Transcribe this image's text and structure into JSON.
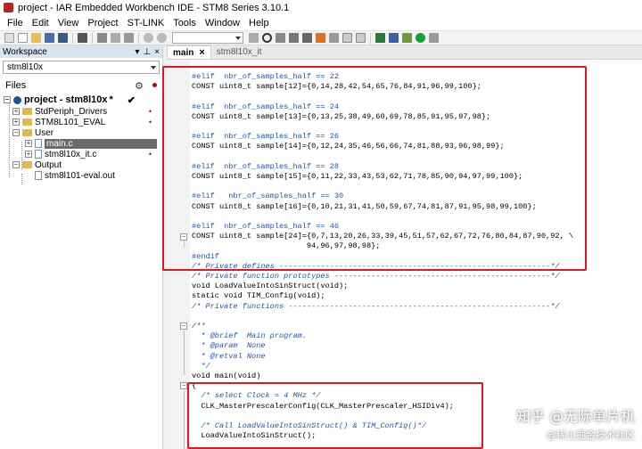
{
  "window": {
    "title": "project - IAR Embedded Workbench IDE - STM8 Series 3.10.1"
  },
  "menu": [
    "File",
    "Edit",
    "View",
    "Project",
    "ST-LINK",
    "Tools",
    "Window",
    "Help"
  ],
  "workspace": {
    "header": "Workspace",
    "selected_config": "stm8l10x",
    "files_label": "Files",
    "tree": [
      {
        "label": "project - stm8l10x",
        "suffix": "*",
        "check": "✔",
        "kind": "project"
      },
      {
        "label": "StdPeriph_Drivers",
        "kind": "folder"
      },
      {
        "label": "STM8L101_EVAL",
        "kind": "folder"
      },
      {
        "label": "User",
        "kind": "folder"
      },
      {
        "label": "main.c",
        "kind": "file",
        "selected": true
      },
      {
        "label": "stm8l10x_it.c",
        "kind": "file"
      },
      {
        "label": "Output",
        "kind": "folder"
      },
      {
        "label": "stm8l101-eval.out",
        "kind": "file"
      }
    ]
  },
  "tabs": [
    {
      "label": "main",
      "active": true,
      "close": "×"
    },
    {
      "label": "stm8l10x_it",
      "active": false
    }
  ],
  "code_lines": [
    {
      "text": "#elif  nbr_of_samples_half == 22",
      "cls": "pp"
    },
    {
      "text": "CONST uint8_t sample[12]={0,14,28,42,54,65,76,84,91,96,99,100};",
      "cls": "kw"
    },
    {
      "text": "",
      "cls": "kw"
    },
    {
      "text": "#elif  nbr_of_samples_half == 24",
      "cls": "pp"
    },
    {
      "text": "CONST uint8_t sample[13]={0,13,25,38,49,60,69,78,85,91,95,97,98};",
      "cls": "kw"
    },
    {
      "text": "",
      "cls": "kw"
    },
    {
      "text": "#elif  nbr_of_samples_half == 26",
      "cls": "pp"
    },
    {
      "text": "CONST uint8_t sample[14]={0,12,24,35,46,56,66,74,81,88,93,96,98,99};",
      "cls": "kw"
    },
    {
      "text": "",
      "cls": "kw"
    },
    {
      "text": "#elif  nbr_of_samples_half == 28",
      "cls": "pp"
    },
    {
      "text": "CONST uint8_t sample[15]={0,11,22,33,43,53,62,71,78,85,90,94,97,99,100};",
      "cls": "kw"
    },
    {
      "text": "",
      "cls": "kw"
    },
    {
      "text": "#elif   nbr_of_samples_half == 30",
      "cls": "pp"
    },
    {
      "text": "CONST uint8_t sample[16]={0,10,21,31,41,50,59,67,74,81,87,91,95,98,99,100};",
      "cls": "kw"
    },
    {
      "text": "",
      "cls": "kw"
    },
    {
      "text": "#elif  nbr_of_samples_half == 46",
      "cls": "pp"
    },
    {
      "text": "CONST uint8_t sample[24]={0,7,13,20,26,33,39,45,51,57,62,67,72,76,80,84,87,90,92, \\",
      "cls": "kw"
    },
    {
      "text": "                         94,96,97,98,98};",
      "cls": "kw"
    },
    {
      "text": "#endif",
      "cls": "pp"
    },
    {
      "text": "/* Private defines -----------------------------------------------------------*/",
      "cls": "cm"
    },
    {
      "text": "/* Private function prototypes -----------------------------------------------*/",
      "cls": "cm"
    },
    {
      "text": "void LoadValueIntoSinStruct(void);",
      "cls": "kw"
    },
    {
      "text": "static void TIM_Config(void);",
      "cls": "kw"
    },
    {
      "text": "/* Private functions ---------------------------------------------------------*/",
      "cls": "cm"
    },
    {
      "text": "",
      "cls": "kw"
    },
    {
      "text": "/**",
      "cls": "cm"
    },
    {
      "text": "  * @brief  Main program.",
      "cls": "cm"
    },
    {
      "text": "  * @param  None",
      "cls": "cm"
    },
    {
      "text": "  * @retval None",
      "cls": "cm"
    },
    {
      "text": "  */",
      "cls": "cm"
    },
    {
      "text": "void main(void)",
      "cls": "kw"
    },
    {
      "text": "{",
      "cls": "kw"
    },
    {
      "text": "  /* select Clock = 4 MHz */",
      "cls": "cm"
    },
    {
      "text": "  CLK_MasterPrescalerConfig(CLK_MasterPrescaler_HSIDiv4);",
      "cls": "kw"
    },
    {
      "text": "",
      "cls": "kw"
    },
    {
      "text": "  /* Call LoadValueIntoSinStruct() & TIM_Config()*/",
      "cls": "cm"
    },
    {
      "text": "  LoadValueIntoSinStruct();",
      "cls": "kw"
    }
  ],
  "watermark": {
    "main": "知乎 @无际单片机",
    "sub": "@稀土掘金技术社区"
  },
  "colors": {
    "highlight": "#e0181f",
    "preprocessor": "#1a56c4",
    "selection": "#6b6b6b"
  }
}
